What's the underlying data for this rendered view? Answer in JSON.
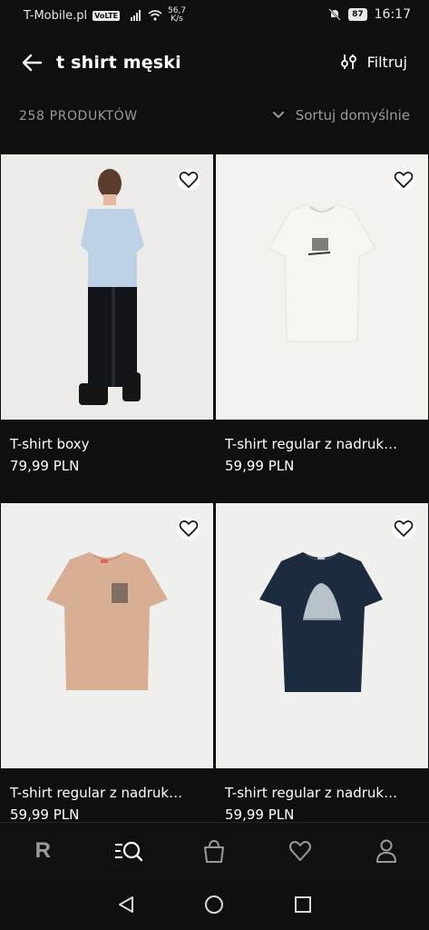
{
  "status_bar": {
    "carrier": "T-Mobile.pl",
    "volte": "VoLTE",
    "speed_value": "56,7",
    "speed_unit": "K/s",
    "battery": "87",
    "time": "16:17"
  },
  "header": {
    "search_query": "t shirt męski",
    "filter_label": "Filtruj"
  },
  "listing": {
    "count_label": "258 PRODUKTÓW",
    "sort_label": "Sortuj domyślnie"
  },
  "products": [
    {
      "name": "T-shirt boxy",
      "price": "79,99 PLN",
      "shirt_color": "#bcd0e6"
    },
    {
      "name": "T-shirt regular z nadruk…",
      "price": "59,99 PLN",
      "shirt_color": "#f6f5ef"
    },
    {
      "name": "T-shirt regular z nadruk…",
      "price": "59,99 PLN",
      "shirt_color": "#d8ae94"
    },
    {
      "name": "T-shirt regular z nadruk…",
      "price": "59,99 PLN",
      "shirt_color": "#1d2b3e"
    }
  ],
  "bottom_nav": [
    {
      "icon": "brand-logo-icon"
    },
    {
      "icon": "search-list-icon"
    },
    {
      "icon": "bag-icon"
    },
    {
      "icon": "heart-icon"
    },
    {
      "icon": "profile-icon"
    }
  ],
  "brand_letter": "R",
  "colors": {
    "background": "#0f0f0f",
    "muted_text": "#9a9a9a",
    "card_bg": "#efefed"
  }
}
